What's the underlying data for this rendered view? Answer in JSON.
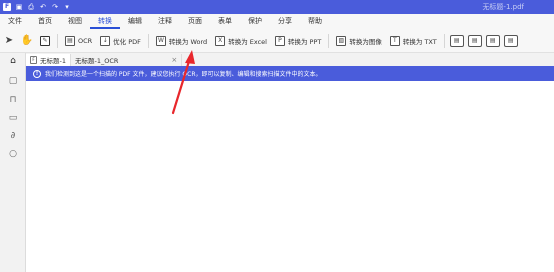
{
  "window": {
    "title": "无标题-1.pdf"
  },
  "menu": [
    "文件",
    "首页",
    "视图",
    "转换",
    "编辑",
    "注释",
    "页面",
    "表单",
    "保护",
    "分享",
    "帮助"
  ],
  "menu_active_index": 3,
  "toolbar": {
    "ocr_label": "OCR",
    "optimize_label": "优化 PDF",
    "to_word_label": "转换为 Word",
    "to_excel_label": "转换为 Excel",
    "to_ppt_label": "转换为 PPT",
    "to_image_label": "转换为图像",
    "to_txt_label": "转换为 TXT"
  },
  "tabs": [
    {
      "label": "无标题-1"
    },
    {
      "label": "无标题-1_OCR"
    }
  ],
  "notice": {
    "text": "我们检测到这是一个扫描的 PDF 文件，建议您执行 OCR，即可以复制、编辑和搜索扫描文件中的文本。"
  },
  "colors": {
    "accent": "#4a5cdb",
    "arrow": "#e8272c"
  },
  "icons": {
    "title_bar": [
      "app-logo-icon",
      "save-icon",
      "print-icon",
      "undo-icon",
      "redo-icon",
      "dropdown-icon"
    ],
    "sidebar": [
      "home-icon",
      "thumbnail-icon",
      "bookmark-icon",
      "comment-icon",
      "attachment-icon",
      "search-icon"
    ]
  }
}
